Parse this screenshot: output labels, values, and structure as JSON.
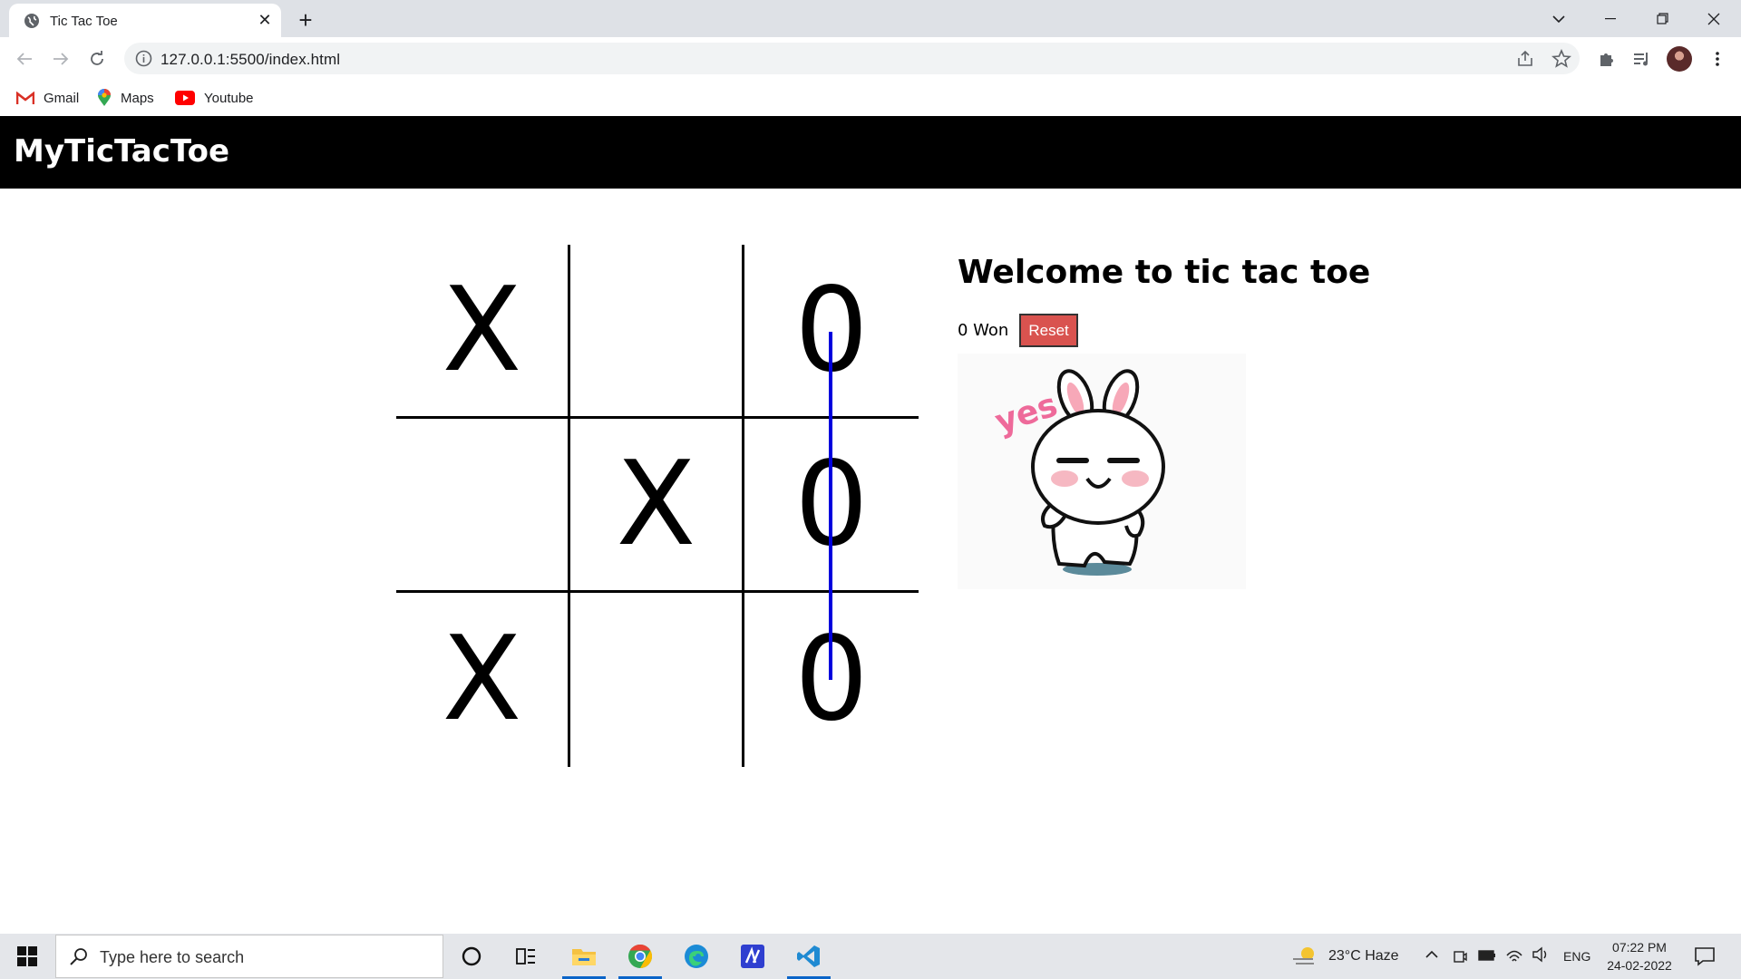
{
  "browser": {
    "tab_title": "Tic Tac Toe",
    "url": "127.0.0.1:5500/index.html",
    "bookmarks": [
      {
        "label": "Gmail"
      },
      {
        "label": "Maps"
      },
      {
        "label": "Youtube"
      }
    ]
  },
  "page": {
    "site_title": "MyTicTacToe",
    "board": [
      [
        "X",
        "",
        "0"
      ],
      [
        "",
        "X",
        "0"
      ],
      [
        "X",
        "",
        "0"
      ]
    ],
    "winning_line": "column-3",
    "winning_line_color": "#0000dd",
    "info_title": "Welcome to tic tac toe",
    "status": "0 Won",
    "reset_label": "Reset",
    "reset_color": "#d9534f"
  },
  "taskbar": {
    "search_placeholder": "Type here to search",
    "weather": "23°C  Haze",
    "language": "ENG",
    "time": "07:22 PM",
    "date": "24-02-2022"
  }
}
